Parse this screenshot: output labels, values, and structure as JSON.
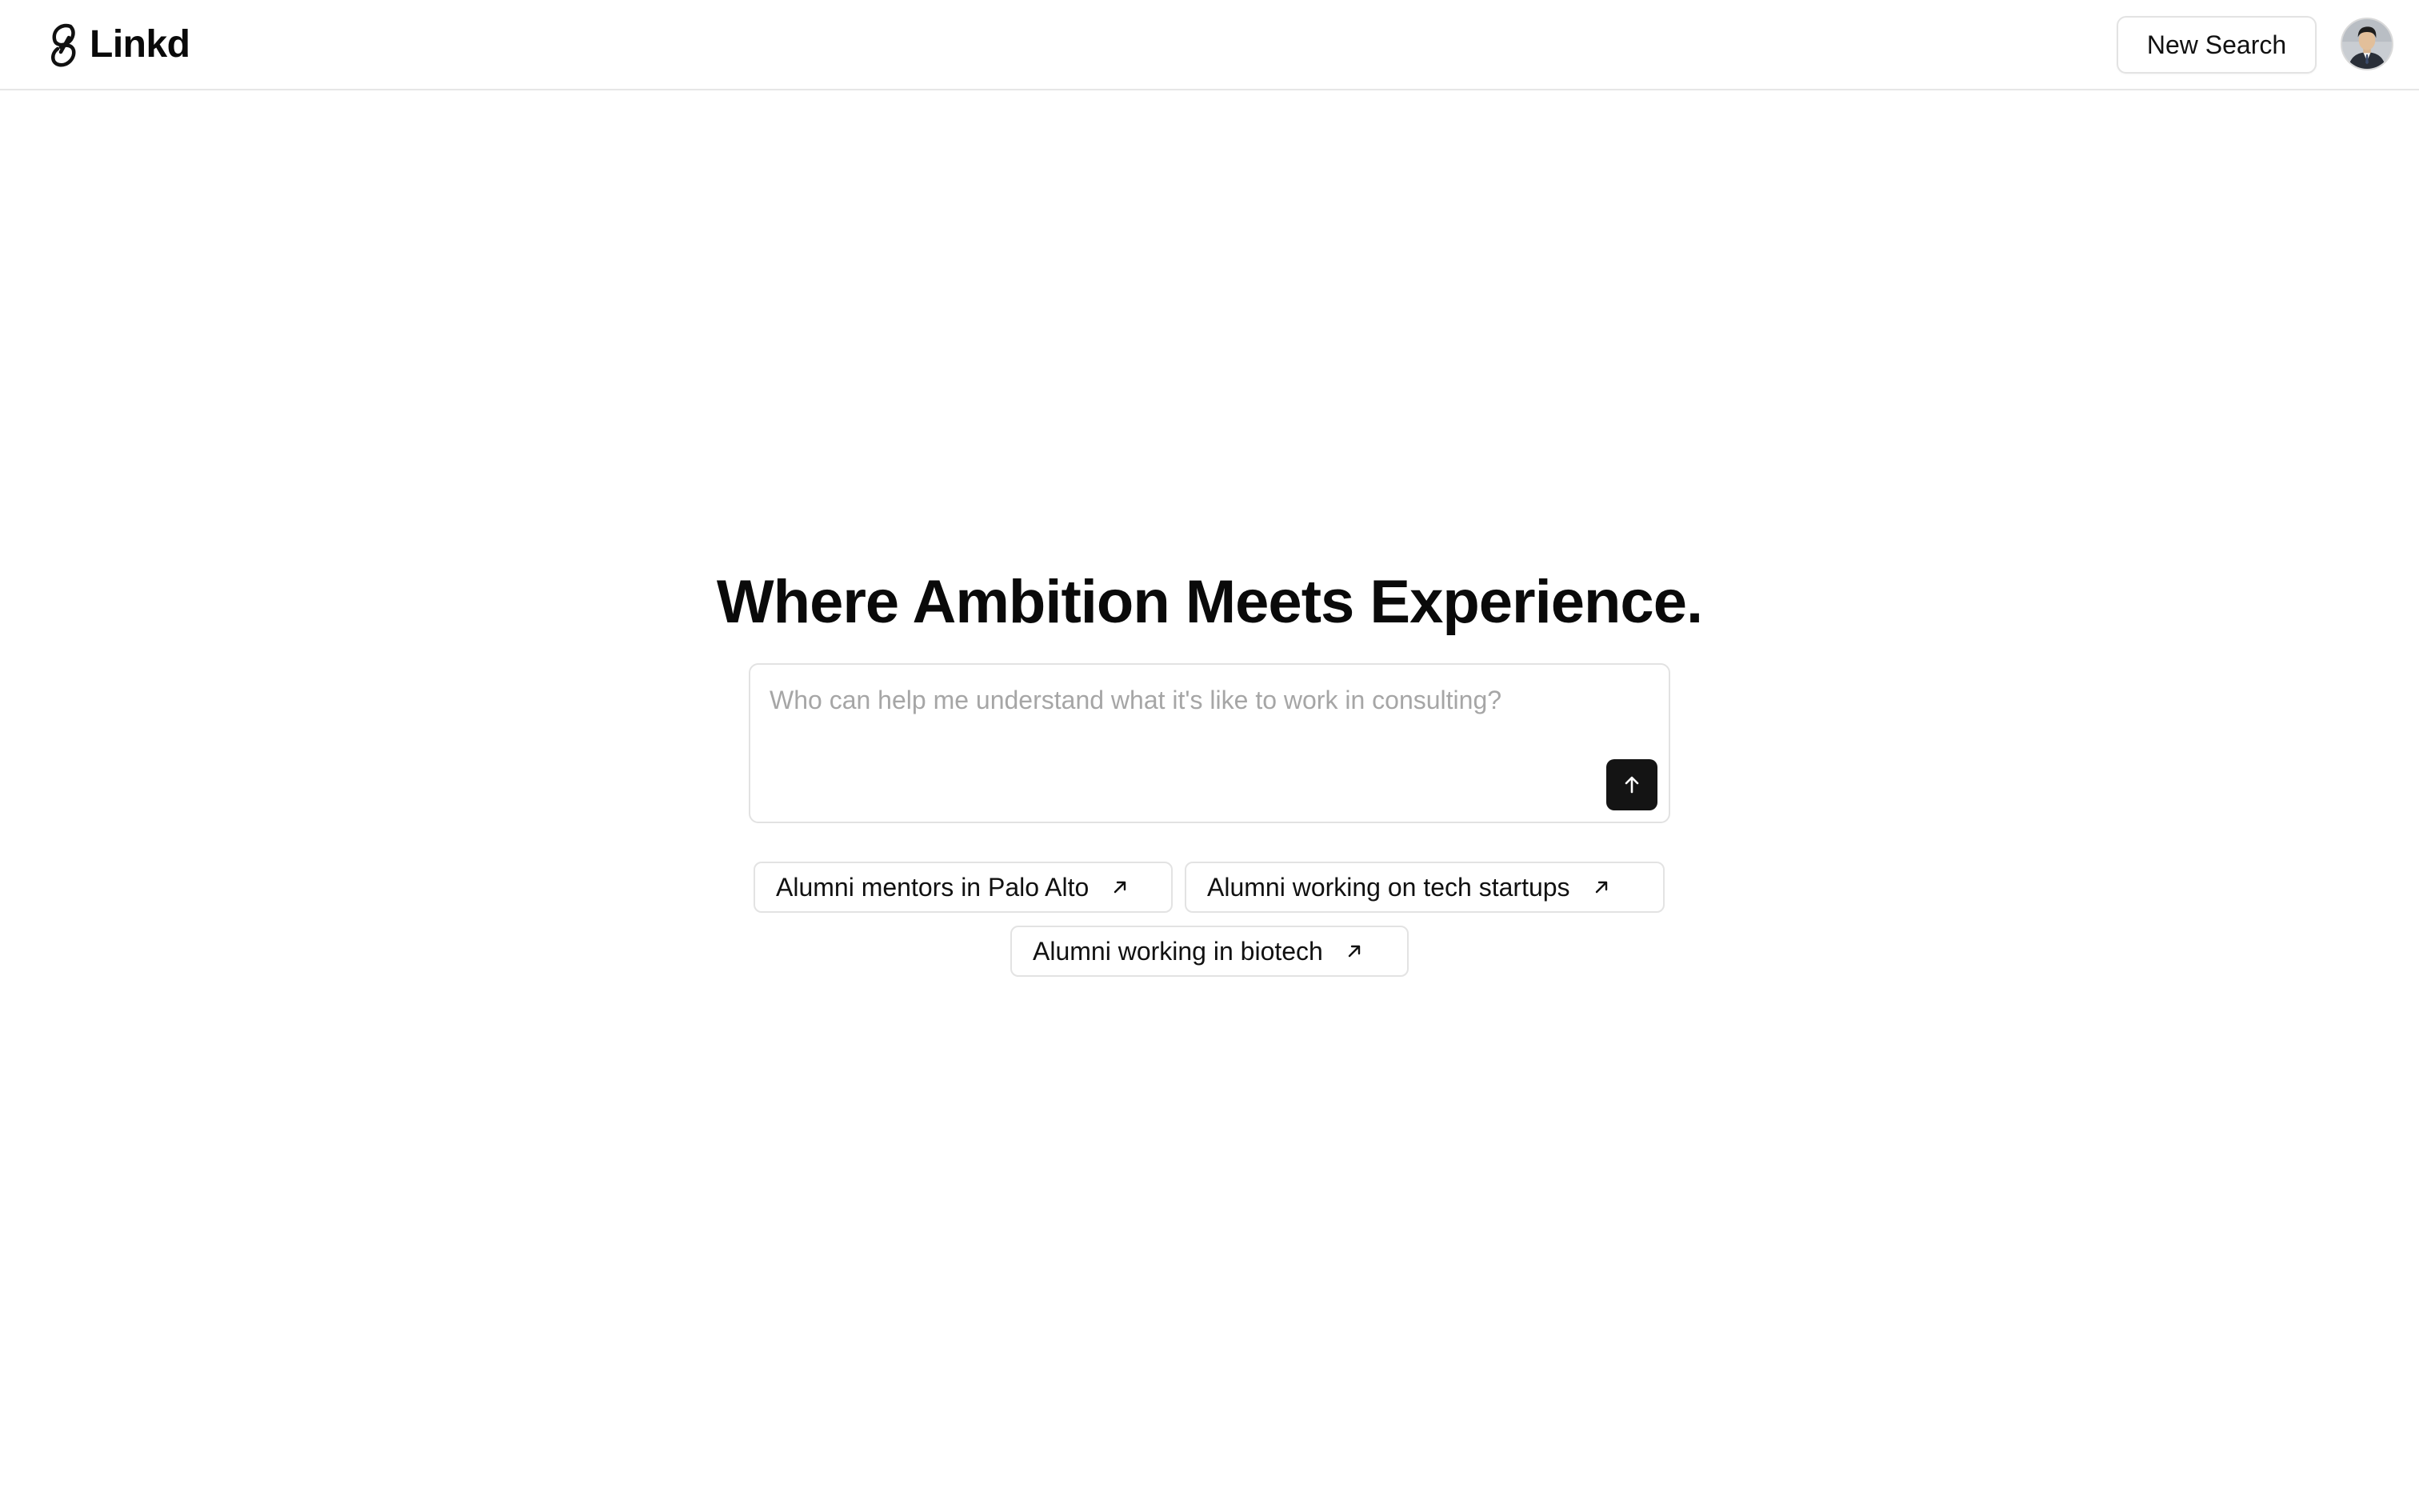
{
  "header": {
    "brand_name": "Linkd",
    "brand_icon": "linkd-logo-icon",
    "new_search_label": "New Search",
    "avatar_icon": "user-avatar"
  },
  "main": {
    "headline": "Where Ambition Meets Experience.",
    "search": {
      "placeholder": "Who can help me understand what it's like to work in consulting?",
      "value": "",
      "submit_icon": "arrow-up-icon"
    },
    "suggestions": [
      {
        "label": "Alumni mentors in Palo Alto",
        "icon": "arrow-up-right-icon"
      },
      {
        "label": "Alumni working on tech startups",
        "icon": "arrow-up-right-icon"
      },
      {
        "label": "Alumni working in biotech",
        "icon": "arrow-up-right-icon"
      }
    ]
  },
  "colors": {
    "background": "#ffffff",
    "text": "#0a0a0a",
    "border": "#e3e3e3",
    "submit_button": "#141414",
    "placeholder": "#a6a6a6"
  }
}
